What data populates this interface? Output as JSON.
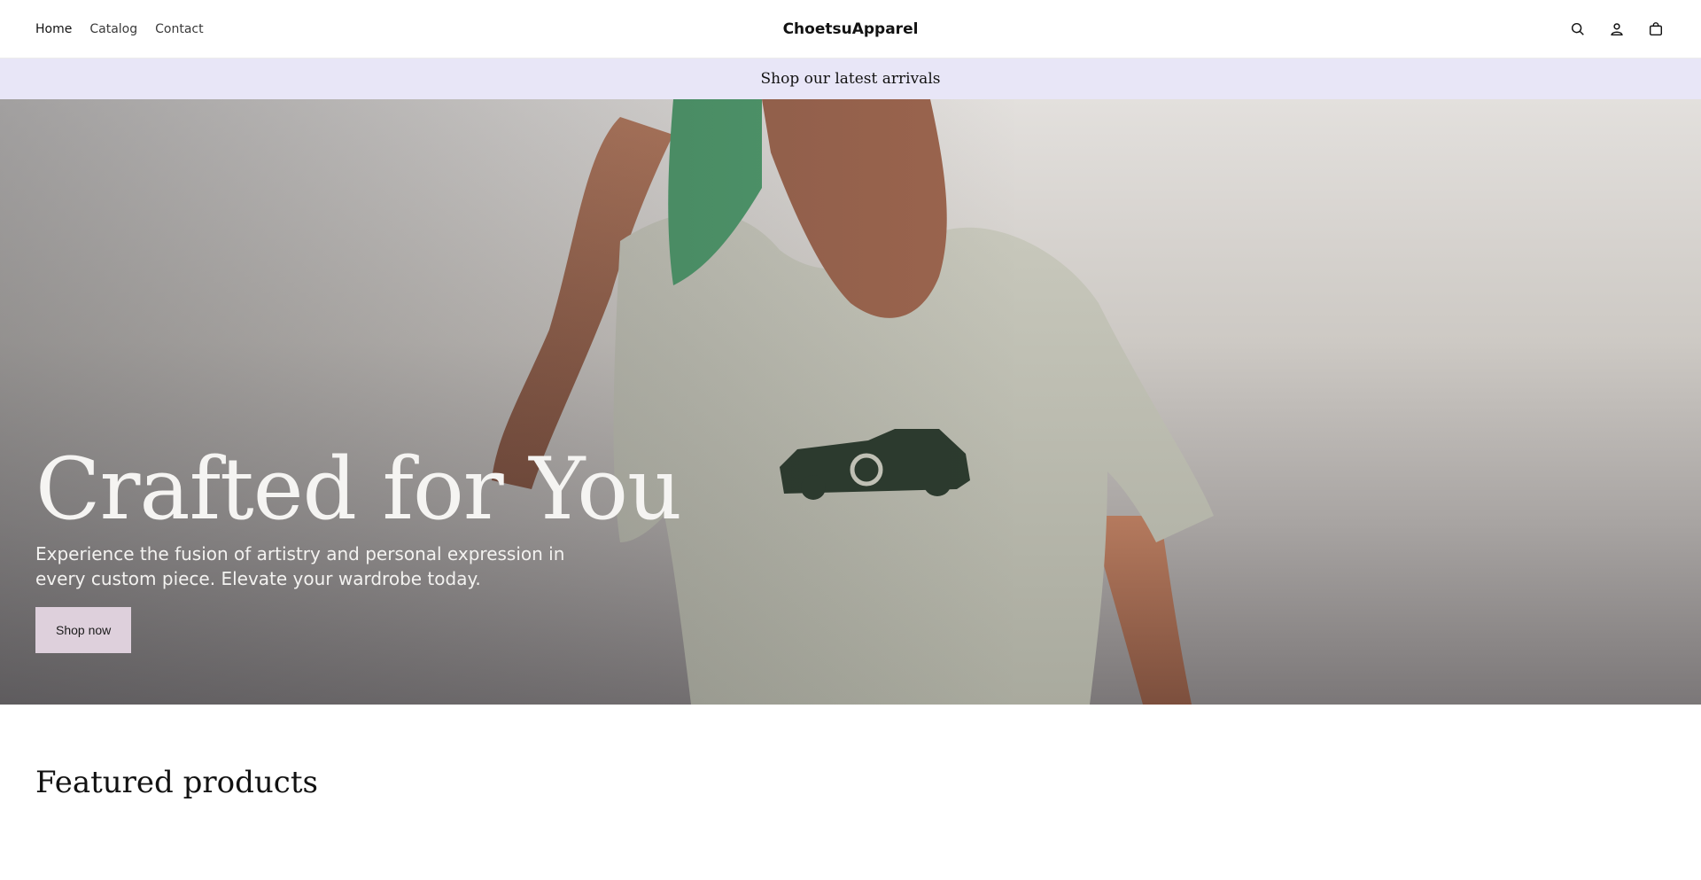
{
  "header": {
    "nav": [
      {
        "label": "Home"
      },
      {
        "label": "Catalog"
      },
      {
        "label": "Contact"
      }
    ],
    "brand": "ChoetsuApparel",
    "icons": [
      "search-icon",
      "account-icon",
      "cart-icon"
    ]
  },
  "announcement": {
    "text": "Shop our latest arrivals",
    "background": "#e8e6f7"
  },
  "hero": {
    "title": "Crafted for You",
    "subtitle": "Experience the fusion of artistry and personal expression in every custom piece. Elevate your wardrobe today.",
    "button_label": "Shop now",
    "button_color": "#ded0dc"
  },
  "featured": {
    "heading": "Featured products"
  }
}
